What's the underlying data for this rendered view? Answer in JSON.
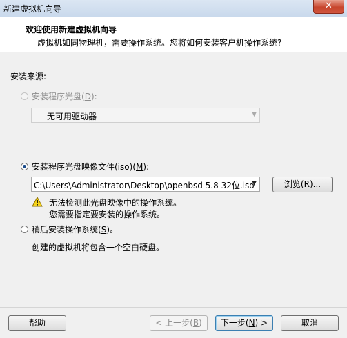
{
  "window": {
    "title": "新建虚拟机向导",
    "close": "✕"
  },
  "header": {
    "title": "欢迎使用新建虚拟机向导",
    "subtitle": "虚拟机如同物理机，需要操作系统。您将如何安装客户机操作系统?"
  },
  "install_source": {
    "label": "安装来源:",
    "disc": {
      "label_pre": "安装程序光盘(",
      "mnemonic": "D",
      "label_post": "):",
      "drive_value": "无可用驱动器",
      "selected": false,
      "enabled": false
    },
    "iso": {
      "label_pre": "安装程序光盘映像文件(iso)(",
      "mnemonic": "M",
      "label_post": "):",
      "path": "C:\\Users\\Administrator\\Desktop\\openbsd 5.8 32位.iso",
      "selected": true,
      "browse_pre": "浏览(",
      "browse_mnemonic": "R",
      "browse_post": ")...",
      "warning_line1": "无法检测此光盘映像中的操作系统。",
      "warning_line2": "您需要指定要安装的操作系统。"
    },
    "later": {
      "label_pre": "稍后安装操作系统(",
      "mnemonic": "S",
      "label_post": ")。",
      "note": "创建的虚拟机将包含一个空白硬盘。",
      "selected": false
    }
  },
  "footer": {
    "help": "帮助",
    "back_pre": "< 上一步(",
    "back_mnemonic": "B",
    "back_post": ")",
    "next_pre": "下一步(",
    "next_mnemonic": "N",
    "next_post": ") >",
    "cancel": "取消"
  }
}
